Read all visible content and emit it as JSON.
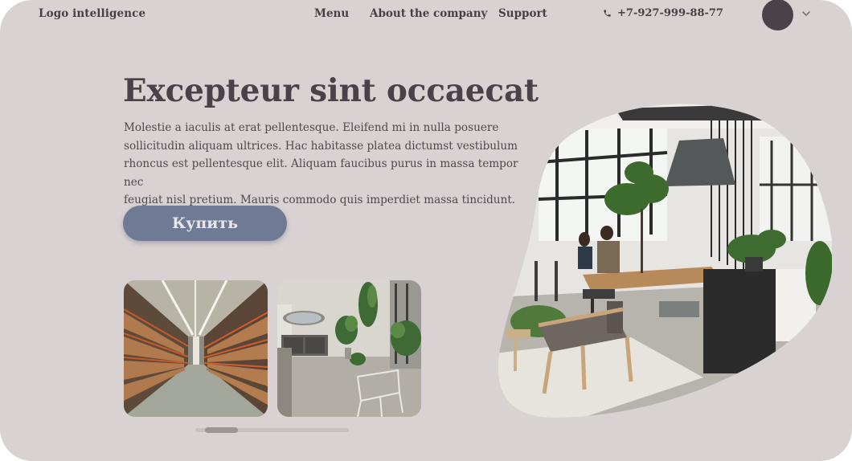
{
  "header": {
    "logo": "Logo intelligence",
    "nav": {
      "menu": "Menu",
      "about": "About the company",
      "support": "Support"
    },
    "phone": "+7-927-999-88-77",
    "icons": {
      "phone": "phone-icon",
      "dropdown": "chevron-down-icon"
    }
  },
  "hero": {
    "title": "Excepteur sint occaecat",
    "description_lines": [
      "Molestie a iaculis at erat pellentesque. Eleifend mi in nulla posuere",
      "sollicitudin aliquam ultrices. Hac habitasse platea dictumst vestibulum",
      "rhoncus est pellentesque elit. Aliquam faucibus purus in massa tempor nec",
      "feugiat nisl pretium. Mauris commodo quis imperdiet massa tincidunt."
    ],
    "button_label": "Купить"
  },
  "gallery": {
    "items": [
      "warehouse-photo",
      "office-interior-photo"
    ],
    "scroll_position": 0.06
  },
  "colors": {
    "background": "#d9d2d2",
    "text": "#4a4249",
    "button": "#6f7a95",
    "avatar": "#4a4249"
  }
}
